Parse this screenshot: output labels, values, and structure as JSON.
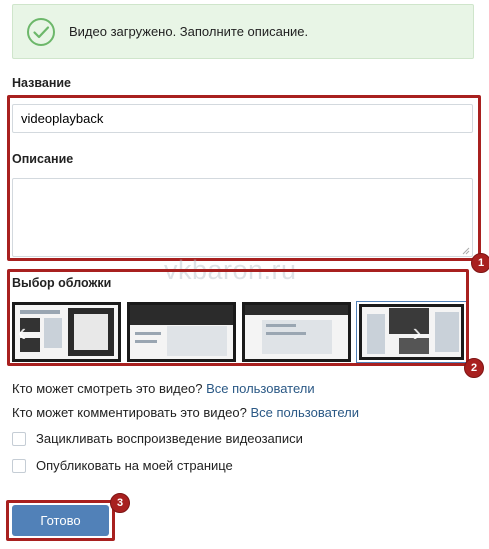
{
  "alert": {
    "text": "Видео загружено. Заполните описание.",
    "icon": "checkmark-circle-icon"
  },
  "form": {
    "title_label": "Название",
    "title_value": "videoplayback",
    "description_label": "Описание",
    "description_value": "",
    "cover_label": "Выбор обложки"
  },
  "watermark": "vkbaron.ru",
  "privacy": {
    "view_question": "Кто может смотреть это видео?",
    "view_value": "Все пользователи",
    "comment_question": "Кто может комментировать это видео?",
    "comment_value": "Все пользователи"
  },
  "options": {
    "loop_label": "Зацикливать воспроизведение видеозаписи",
    "publish_label": "Опубликовать на моей странице"
  },
  "submit_label": "Готово",
  "annotations": {
    "badge1": "1",
    "badge2": "2",
    "badge3": "3"
  },
  "colors": {
    "accent": "#5181b8",
    "link": "#2a5885",
    "annotation": "#a8201f",
    "success_bg": "#e8f5e6"
  }
}
